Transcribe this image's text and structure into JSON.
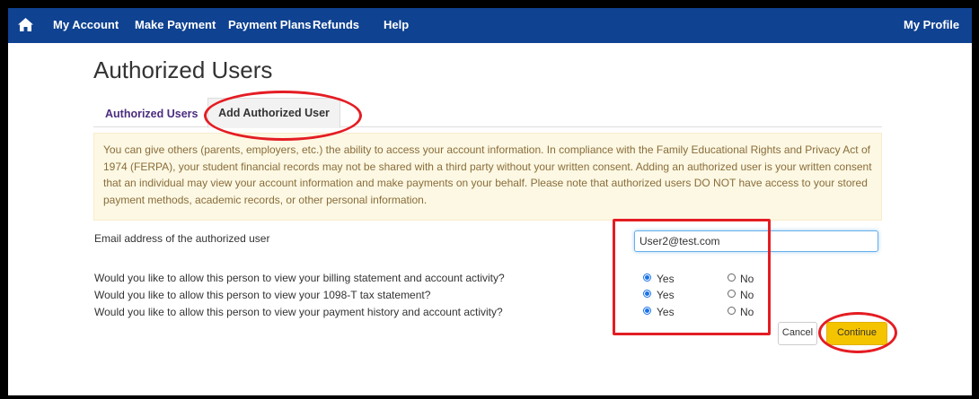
{
  "nav": {
    "home_icon": "home-icon",
    "items": [
      "My Account",
      "Make Payment",
      "Payment Plans",
      "Refunds",
      "Help"
    ],
    "profile": "My Profile"
  },
  "page": {
    "title": "Authorized Users"
  },
  "tabs": [
    "Authorized Users",
    "Add Authorized User"
  ],
  "notice": "You can give others (parents, employers, etc.) the ability to access your account information. In compliance with the Family Educational Rights and Privacy Act of 1974 (FERPA), your student financial records may not be shared with a third party without your written consent. Adding an authorized user is your written consent that an individual may view your account information and make payments on your behalf. Please note that authorized users DO NOT have access to your stored payment methods, academic records, or other personal information.",
  "form": {
    "email_label": "Email address of the authorized user",
    "email_value": "User2@test.com",
    "questions": [
      "Would you like to allow this person to view your billing statement and account activity?",
      "Would you like to allow this person to view your 1098-T tax statement?",
      "Would you like to allow this person to view your payment history and account activity?"
    ],
    "yes_label": "Yes",
    "no_label": "No",
    "selected": [
      "Yes",
      "Yes",
      "Yes"
    ]
  },
  "buttons": {
    "cancel": "Cancel",
    "continue": "Continue"
  },
  "colors": {
    "nav_bg": "#0f4291",
    "continue_bg": "#f5c400",
    "annotation": "#e41d23",
    "radio": "#1a73e8"
  }
}
